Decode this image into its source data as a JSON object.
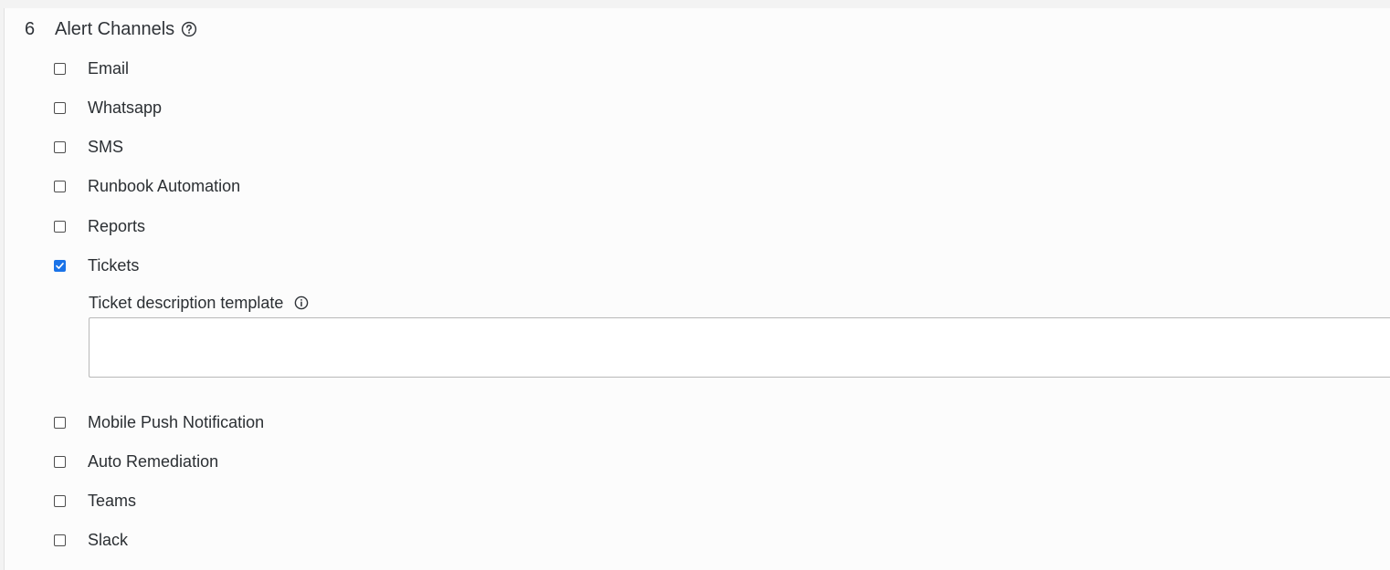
{
  "section": {
    "number": "6",
    "title": "Alert Channels",
    "help_icon": "help-circle-icon"
  },
  "channels": [
    {
      "label": "Email",
      "checked": false
    },
    {
      "label": "Whatsapp",
      "checked": false
    },
    {
      "label": "SMS",
      "checked": false
    },
    {
      "label": "Runbook Automation",
      "checked": false
    },
    {
      "label": "Reports",
      "checked": false
    },
    {
      "label": "Tickets",
      "checked": true
    },
    {
      "label": "Mobile Push Notification",
      "checked": false
    },
    {
      "label": "Auto Remediation",
      "checked": false
    },
    {
      "label": "Teams",
      "checked": false
    },
    {
      "label": "Slack",
      "checked": false
    }
  ],
  "ticket_template": {
    "label": "Ticket description template",
    "info_icon": "info-circle-icon",
    "value": ""
  },
  "colors": {
    "checkbox_checked": "#1a73e8",
    "text": "#2b2f33"
  }
}
